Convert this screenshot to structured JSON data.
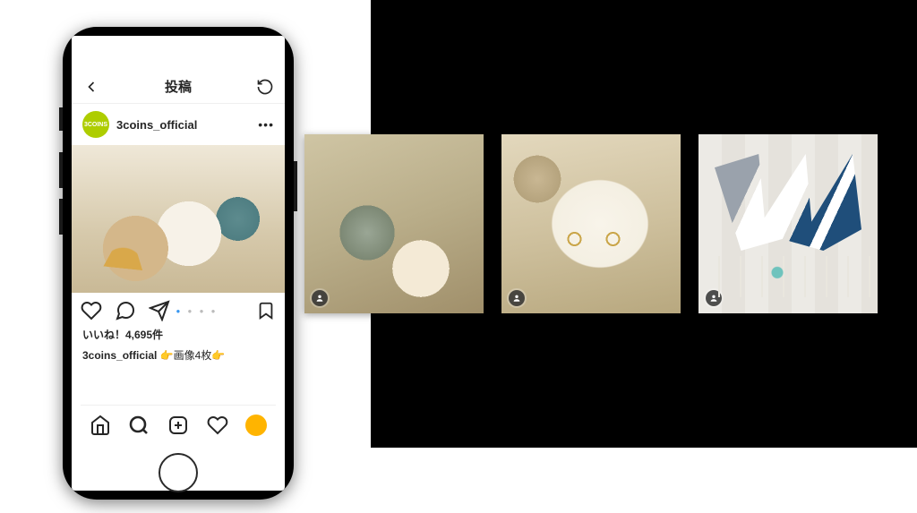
{
  "header": {
    "title": "投稿"
  },
  "post": {
    "avatar_label": "3COINS",
    "username": "3coins_official",
    "more": "•••",
    "likes_text": "いいね！4,695件",
    "caption_user": "3coins_official",
    "caption_text": "👉画像4枚👉",
    "carousel_index": 1,
    "carousel_total": 4
  },
  "thumbnails": [
    {
      "alt": "star-ornament-with-shells"
    },
    {
      "alt": "anchor-earrings-on-shell"
    },
    {
      "alt": "marine-socks-set"
    }
  ]
}
